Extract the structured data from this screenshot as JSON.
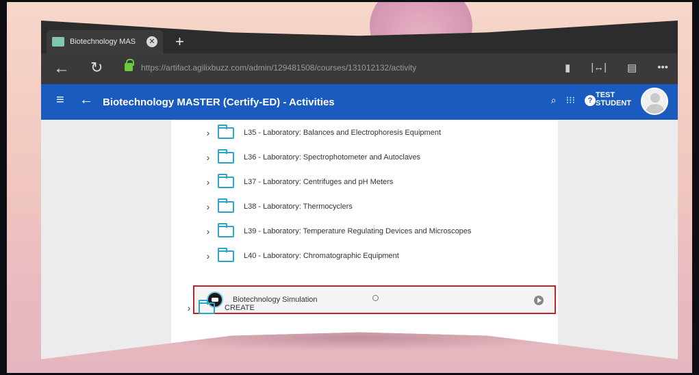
{
  "browser": {
    "tab_title": "Biotechnology MAS",
    "new_tab_label": "+",
    "url": "https://artifact.agilixbuzz.com/admin/129481508/courses/131012132/activity"
  },
  "app": {
    "title": "Biotechnology MASTER (Certify-ED) - Activities",
    "user_line1": "TEST",
    "user_line2": "STUDENT",
    "help_label": "?"
  },
  "activities": [
    {
      "label": "L35 - Laboratory: Balances and Electrophoresis Equipment"
    },
    {
      "label": "L36 - Laboratory: Spectrophotometer and Autoclaves"
    },
    {
      "label": "L37 - Laboratory: Centrifuges and pH Meters"
    },
    {
      "label": "L38 - Laboratory: Thermocyclers"
    },
    {
      "label": "L39 - Laboratory: Temperature Regulating Devices and Microscopes"
    },
    {
      "label": "L40 - Laboratory: Chromatographic Equipment"
    }
  ],
  "simulation": {
    "label": "Biotechnology Simulation"
  },
  "create": {
    "label": "CREATE"
  },
  "colors": {
    "appbar": "#1a5bbf",
    "folder": "#2aa6c9",
    "highlight": "#c1232b"
  }
}
